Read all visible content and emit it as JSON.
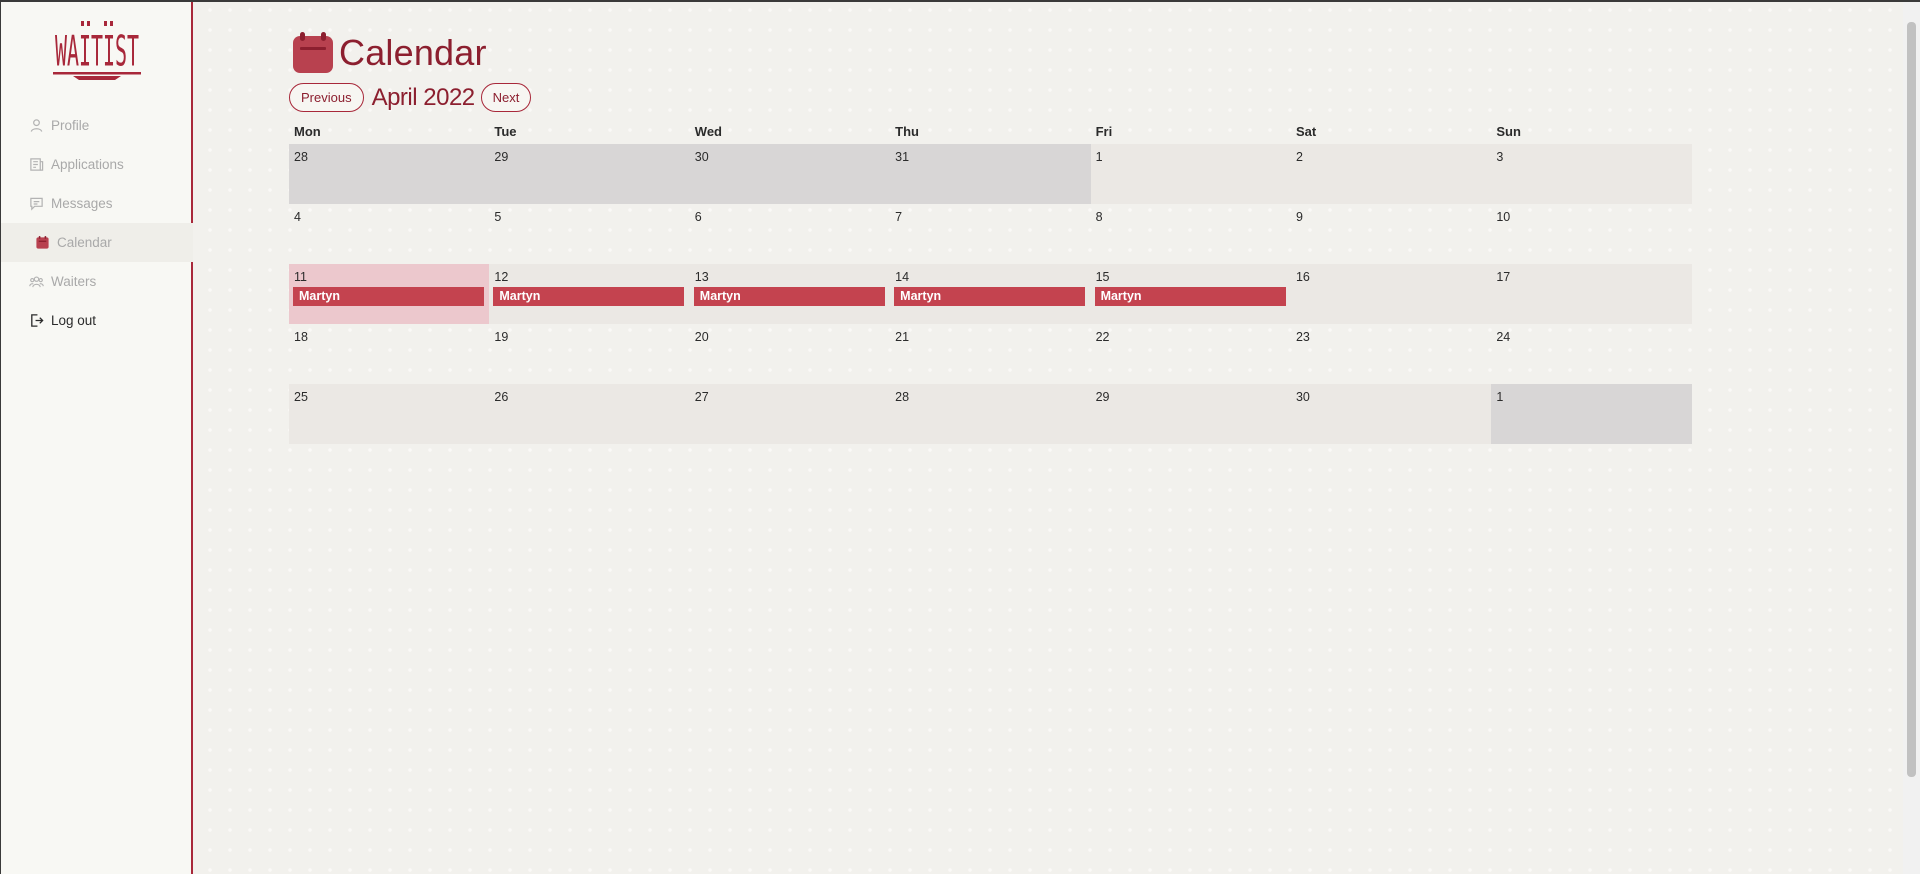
{
  "app": {
    "logo_text": "WAITIST"
  },
  "sidebar": {
    "items": [
      {
        "label": "Profile",
        "icon": "user-icon"
      },
      {
        "label": "Applications",
        "icon": "applications-icon"
      },
      {
        "label": "Messages",
        "icon": "message-icon"
      },
      {
        "label": "Calendar",
        "icon": "calendar-icon",
        "active": true
      },
      {
        "label": "Waiters",
        "icon": "users-icon"
      },
      {
        "label": "Log out",
        "icon": "logout-icon"
      }
    ]
  },
  "page": {
    "title": "Calendar"
  },
  "monthnav": {
    "previous_label": "Previous",
    "month": "April 2022",
    "next_label": "Next"
  },
  "calendar": {
    "weekdays": [
      "Mon",
      "Tue",
      "Wed",
      "Thu",
      "Fri",
      "Sat",
      "Sun"
    ],
    "weeks": [
      [
        "28",
        "29",
        "30",
        "31",
        "1",
        "2",
        "3"
      ],
      [
        "4",
        "5",
        "6",
        "7",
        "8",
        "9",
        "10"
      ],
      [
        "11",
        "12",
        "13",
        "14",
        "15",
        "16",
        "17"
      ],
      [
        "18",
        "19",
        "20",
        "21",
        "22",
        "23",
        "24"
      ],
      [
        "25",
        "26",
        "27",
        "28",
        "29",
        "30",
        "1"
      ]
    ],
    "events": [
      [
        "",
        "",
        "",
        "",
        "",
        "",
        ""
      ],
      [
        "",
        "",
        "",
        "",
        "",
        "",
        ""
      ],
      [
        "Martyn",
        "Martyn",
        "Martyn",
        "Martyn",
        "Martyn",
        "",
        ""
      ],
      [
        "",
        "",
        "",
        "",
        "",
        "",
        ""
      ],
      [
        "",
        "",
        "",
        "",
        "",
        "",
        ""
      ]
    ]
  },
  "colors": {
    "accent": "#8c1f2f",
    "event": "#c4434f",
    "today": "#ecc8cd",
    "outside_month": "#d8d6d6",
    "shaded_week": "#ebe8e4"
  }
}
